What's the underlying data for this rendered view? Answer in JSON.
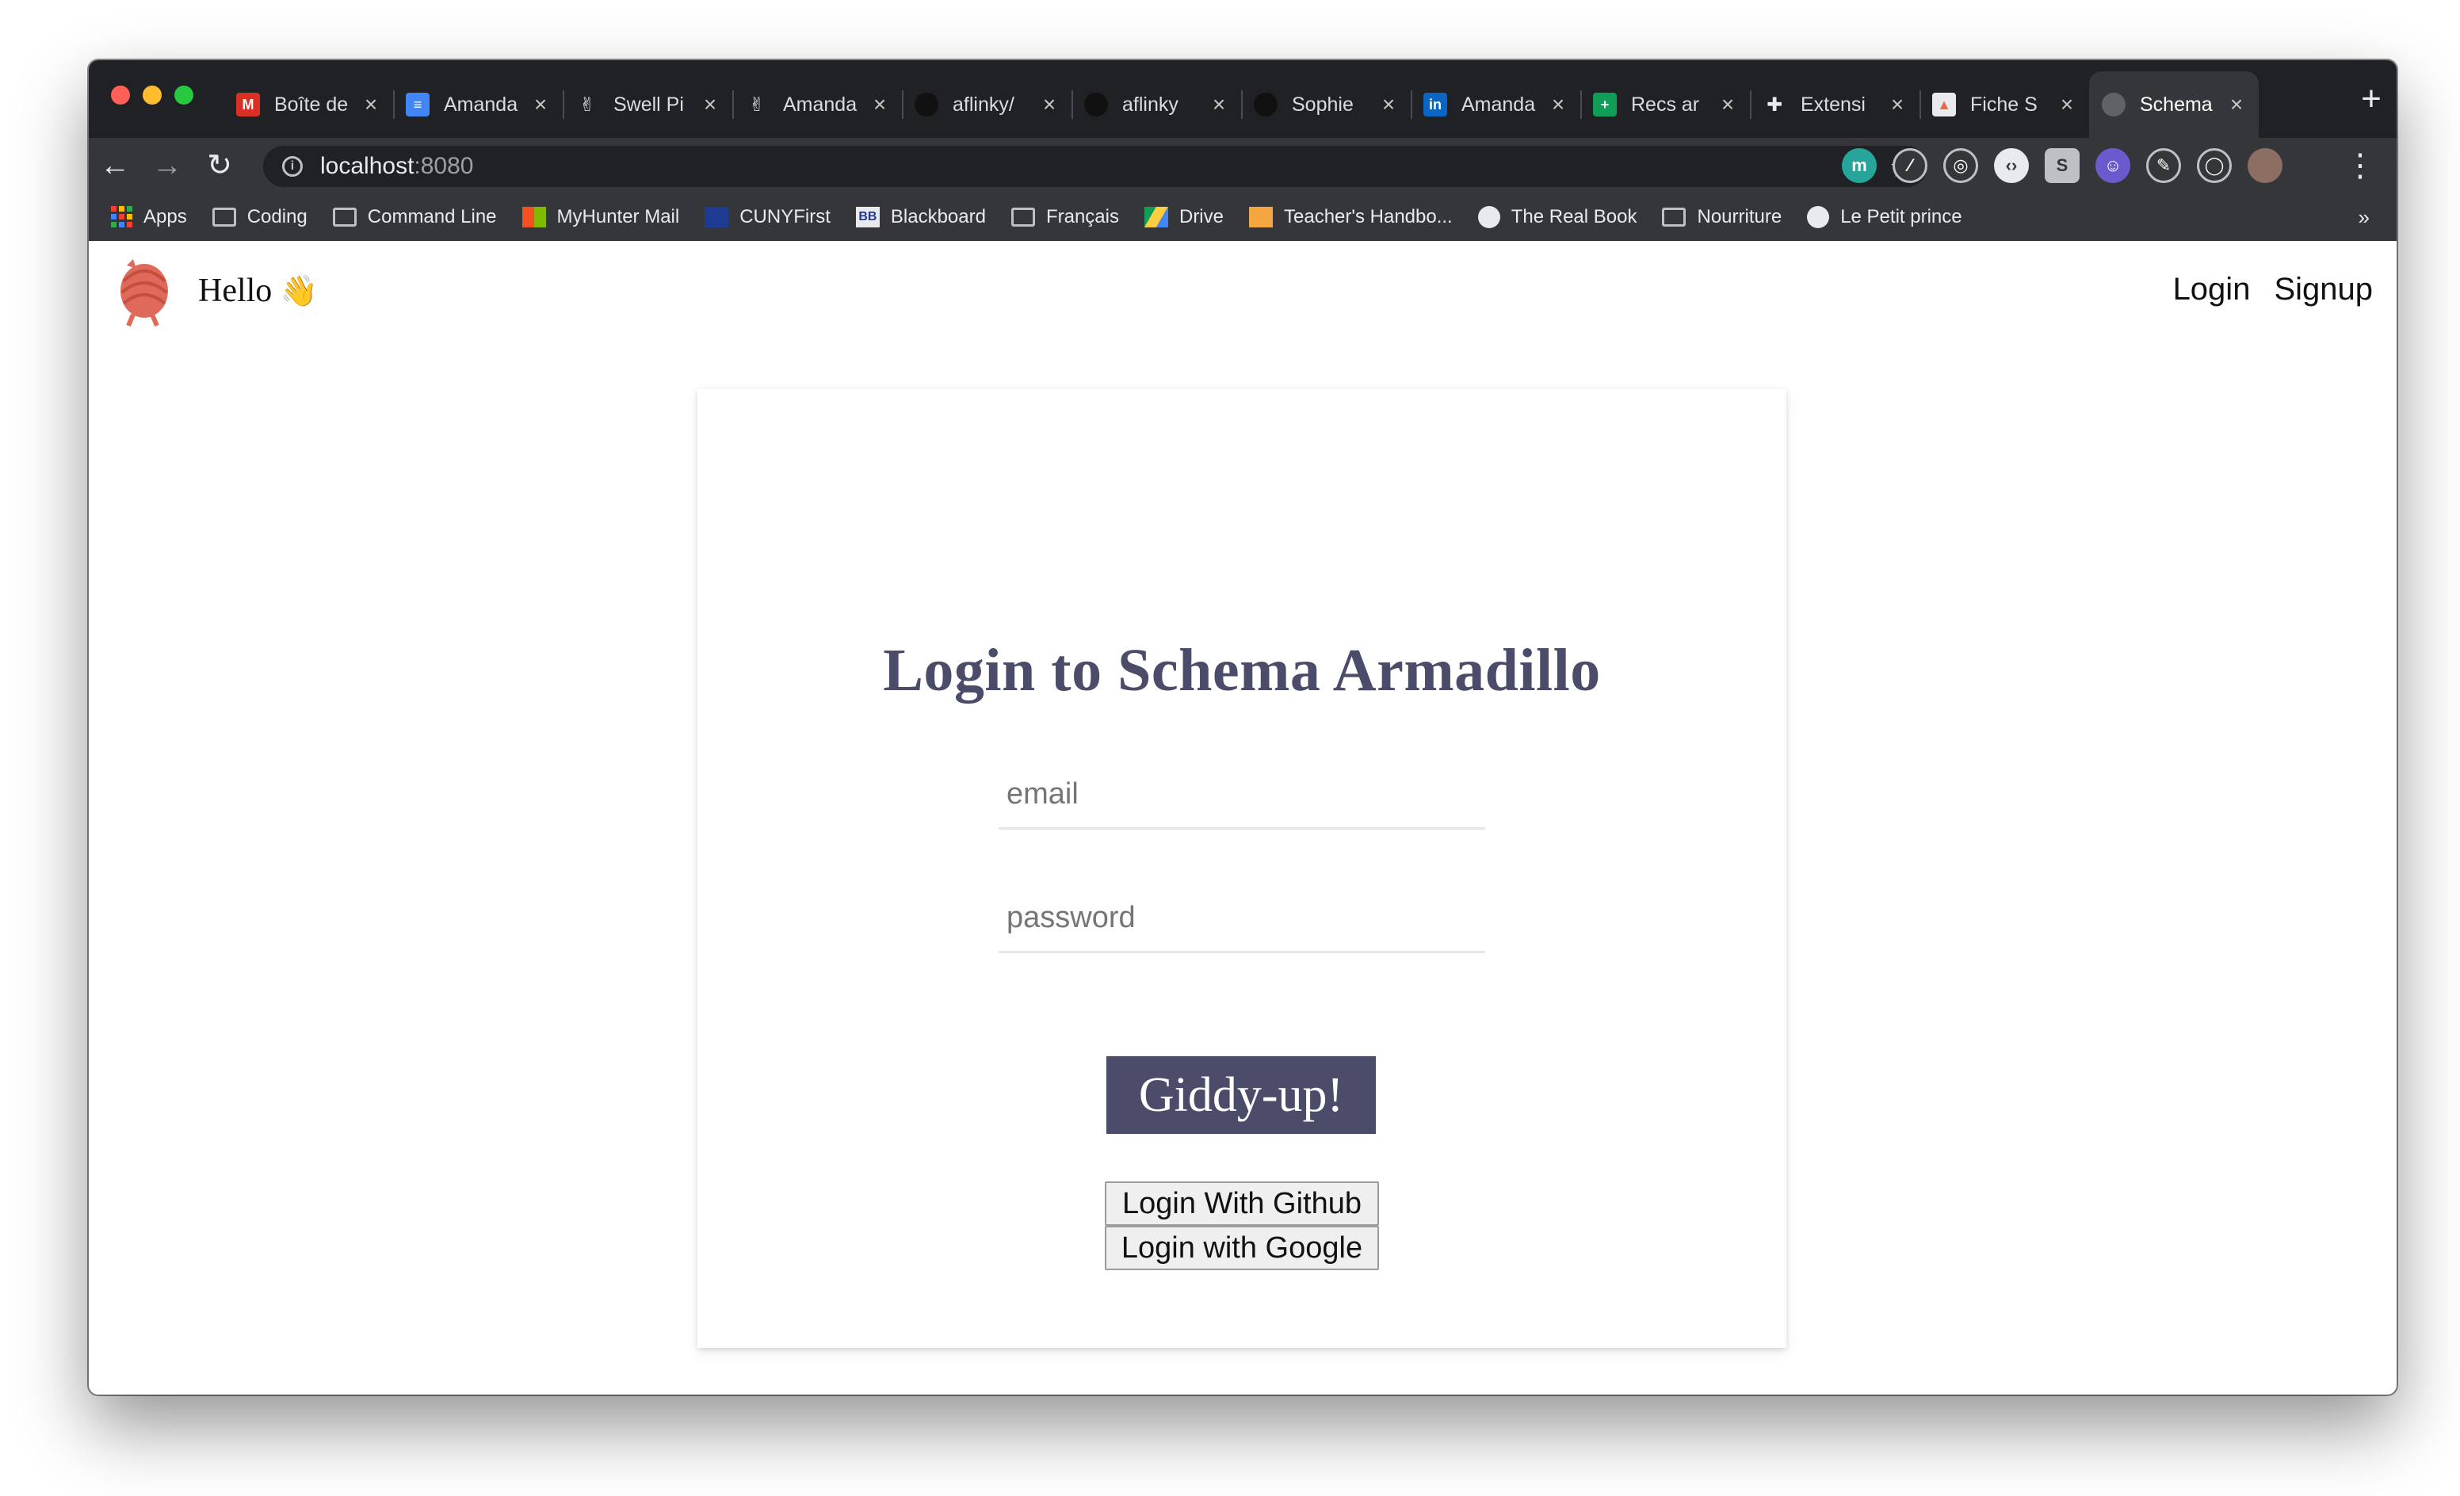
{
  "browser": {
    "tabs": [
      {
        "title": "Boîte de",
        "icon": "gmail-icon",
        "color": "#d93025",
        "glyph": "M"
      },
      {
        "title": "Amanda",
        "icon": "google-docs-icon",
        "color": "#4285f4",
        "glyph": "≡"
      },
      {
        "title": "Swell Pi",
        "icon": "peace-hand-icon",
        "color": "",
        "glyph": "✌"
      },
      {
        "title": "Amanda",
        "icon": "peace-hand-icon",
        "color": "",
        "glyph": "✌"
      },
      {
        "title": "aflinky/",
        "icon": "github-icon",
        "color": "#111111",
        "glyph": ""
      },
      {
        "title": "aflinky",
        "icon": "github-icon",
        "color": "#111111",
        "glyph": ""
      },
      {
        "title": "Sophie",
        "icon": "github-icon",
        "color": "#111111",
        "glyph": ""
      },
      {
        "title": "Amanda",
        "icon": "linkedin-icon",
        "color": "#0a66c2",
        "glyph": "in"
      },
      {
        "title": "Recs ar",
        "icon": "google-sheets-icon",
        "color": "#0f9d58",
        "glyph": "+"
      },
      {
        "title": "Extensi",
        "icon": "puzzle-icon",
        "color": "",
        "glyph": "✚"
      },
      {
        "title": "Fiche S",
        "icon": "image-icon",
        "color": "#e8eaed",
        "glyph": "▲"
      },
      {
        "title": "Schema",
        "icon": "globe-icon",
        "color": "#5f6368",
        "glyph": "",
        "active": true
      }
    ],
    "url_host": "localhost",
    "url_port": ":8080",
    "extensions": [
      {
        "icon": "teal-circle-extension-icon",
        "color": "#26a69a",
        "glyph": "m"
      },
      {
        "icon": "eyedropper-extension-icon",
        "color": "#35363a",
        "glyph": "⁄"
      },
      {
        "icon": "target-extension-icon",
        "color": "#35363a",
        "glyph": "◎"
      },
      {
        "icon": "code-extension-icon",
        "color": "#e8eaed",
        "glyph": "‹›"
      },
      {
        "icon": "s-extension-icon",
        "color": "#bdc1c6",
        "glyph": "S"
      },
      {
        "icon": "robot-extension-icon",
        "color": "#6a5acd",
        "glyph": "☺"
      },
      {
        "icon": "pen-extension-icon",
        "color": "#35363a",
        "glyph": "✎"
      },
      {
        "icon": "ring-extension-icon",
        "color": "#35363a",
        "glyph": "◯"
      },
      {
        "icon": "profile-avatar-icon",
        "color": "#8d6e63",
        "glyph": ""
      }
    ],
    "bookmarks": [
      {
        "label": "Apps",
        "icon": "apps-grid-icon"
      },
      {
        "label": "Coding",
        "icon": "folder-icon"
      },
      {
        "label": "Command Line",
        "icon": "folder-icon"
      },
      {
        "label": "MyHunter Mail",
        "icon": "microsoft-icon"
      },
      {
        "label": "CUNYFirst",
        "icon": "cuny-icon"
      },
      {
        "label": "Blackboard",
        "icon": "blackboard-icon"
      },
      {
        "label": "Français",
        "icon": "folder-icon"
      },
      {
        "label": "Drive",
        "icon": "google-drive-icon"
      },
      {
        "label": "Teacher's Handbo...",
        "icon": "book-icon"
      },
      {
        "label": "The Real Book",
        "icon": "globe-icon"
      },
      {
        "label": "Nourriture",
        "icon": "folder-icon"
      },
      {
        "label": "Le Petit prince",
        "icon": "globe-icon"
      }
    ],
    "bookmarks_more": "»"
  },
  "site": {
    "greeting": "Hello",
    "greeting_emoji": "👋",
    "nav": {
      "login": "Login",
      "signup": "Signup"
    }
  },
  "login_card": {
    "title": "Login to Schema Armadillo",
    "email_placeholder": "email",
    "password_placeholder": "password",
    "submit": "Giddy-up!",
    "github": "Login With Github",
    "google": "Login with Google"
  },
  "colors": {
    "accent": "#4a4c6a",
    "logo": "#e06a5a"
  }
}
